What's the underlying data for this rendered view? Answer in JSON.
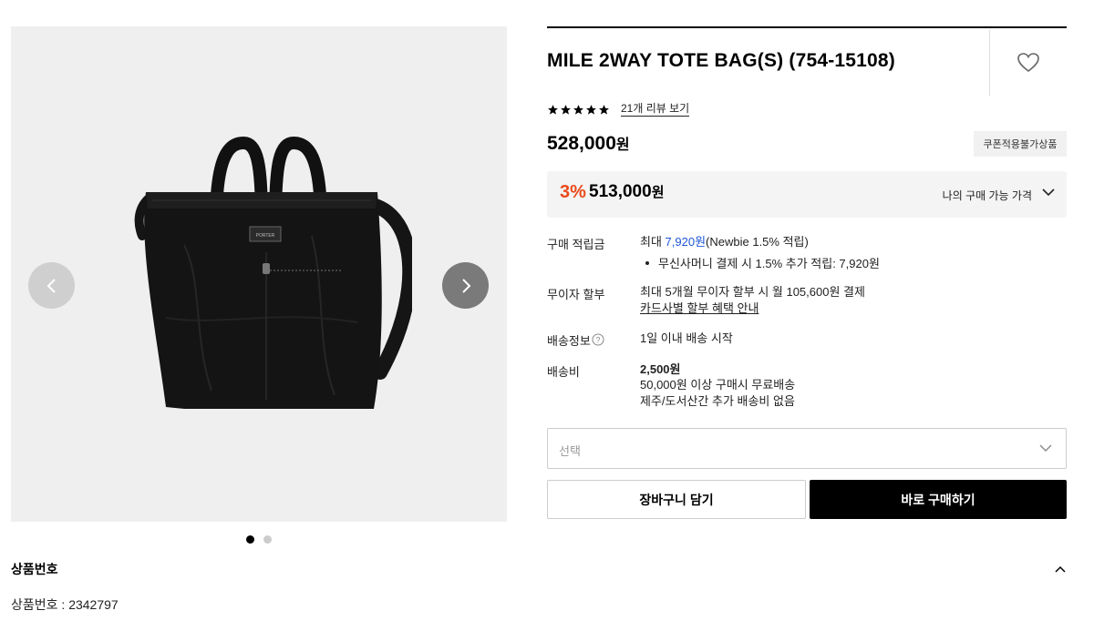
{
  "product": {
    "title": "MILE 2WAY TOTE BAG(S) (754-15108)",
    "review_link": "21개 리뷰 보기",
    "rating_stars": 5,
    "price_value": "528,000",
    "price_unit": "원",
    "coupon_badge": "쿠폰적용불가상품",
    "discount_rate": "3%",
    "discount_price": "513,000",
    "discount_unit": "원",
    "my_price_label": "나의 구매 가능 가격"
  },
  "gallery": {
    "total_images": 2,
    "active_index": 1,
    "bag_label": "PORTER"
  },
  "points": {
    "label": "구매 적립금",
    "prefix": "최대 ",
    "amount": "7,920원",
    "suffix": "(Newbie 1.5% 적립)",
    "bullet": "무신사머니 결제 시 1.5% 추가 적립: 7,920원"
  },
  "installment": {
    "label": "무이자 할부",
    "text": "최대 5개월 무이자 할부 시 월 105,600원 결제",
    "link": "카드사별 할부 혜택 안내"
  },
  "shipping_info": {
    "label": "배송정보",
    "text": "1일 이내 배송 시작"
  },
  "shipping_fee": {
    "label": "배송비",
    "amount": "2,500원",
    "free_condition": "50,000원 이상 구매시 무료배송",
    "island": "제주/도서산간 추가 배송비 없음"
  },
  "option_select": {
    "placeholder": "선택"
  },
  "buttons": {
    "cart": "장바구니 담기",
    "buy": "바로 구매하기"
  },
  "product_number": {
    "section_title": "상품번호",
    "text": "상품번호 : 2342797"
  },
  "colors": {
    "discount": "#ea4a1a",
    "points_blue": "#1e56d6",
    "buy_button": "#000000"
  }
}
